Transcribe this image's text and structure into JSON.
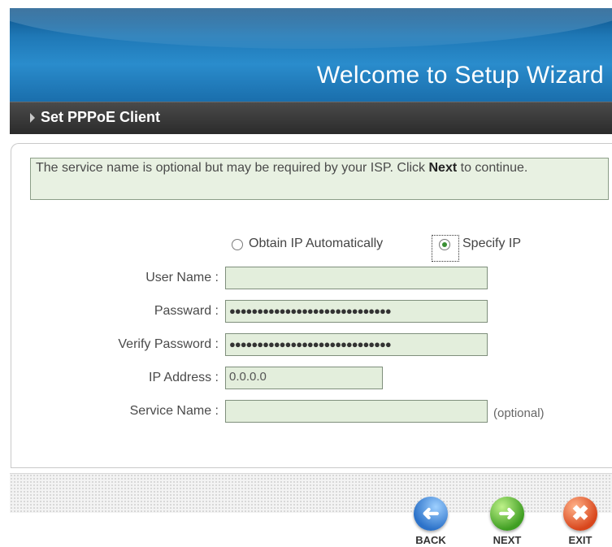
{
  "header": {
    "title": "Welcome to Setup Wizard"
  },
  "section": {
    "title": "Set PPPoE Client"
  },
  "info": {
    "text_before": "The service name is optional but may be required by your ISP. Click ",
    "bold": "Next",
    "text_after": " to continue."
  },
  "radio": {
    "obtain_label": "Obtain IP Automatically",
    "specify_label": "Specify IP",
    "selected": "Specify IP"
  },
  "form": {
    "user_name_label": "User Name :",
    "user_name_value": "",
    "password_label": "Passward :",
    "password_value": "●●●●●●●●●●●●●●●●●●●●●●●●●●●●●",
    "verify_label": "Verify Password :",
    "verify_value": "●●●●●●●●●●●●●●●●●●●●●●●●●●●●●",
    "ip_label": "IP Address :",
    "ip_value": "0.0.0.0",
    "service_label": "Service Name :",
    "service_value": "",
    "optional_note": "(optional)"
  },
  "nav": {
    "back": "BACK",
    "next": "NEXT",
    "exit": "EXIT"
  }
}
